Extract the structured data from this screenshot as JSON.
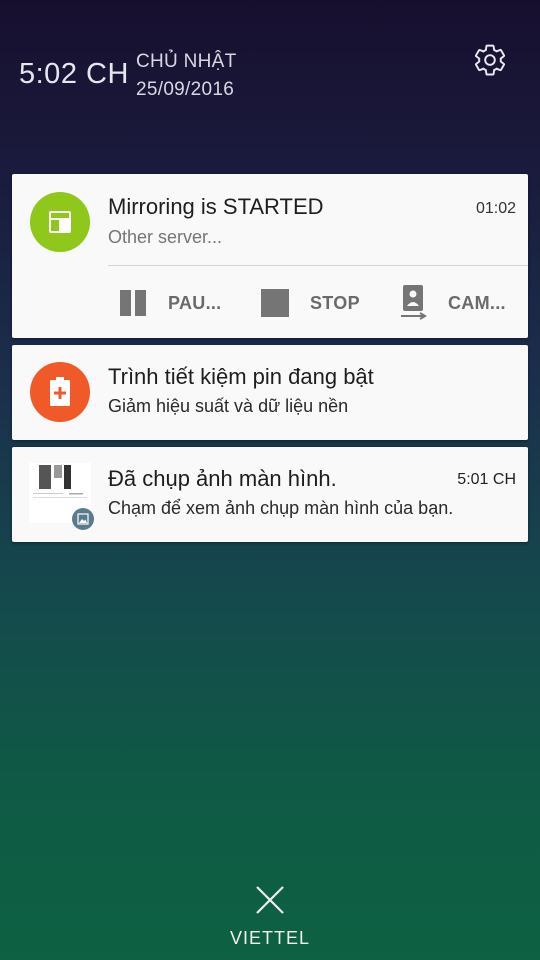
{
  "header": {
    "clock": "5:02 CH",
    "day_name": "CHỦ NHẬT",
    "date": "25/09/2016",
    "settings_icon": "gear-icon"
  },
  "notifications": [
    {
      "app_icon": "screen-mirror-icon",
      "icon_color": "#8fc71b",
      "title": "Mirroring is STARTED",
      "subtitle": "Other server...",
      "time": "01:02",
      "actions": [
        {
          "label": "PAU...",
          "icon": "pause-icon"
        },
        {
          "label": "STOP",
          "icon": "stop-icon"
        },
        {
          "label": "CAM...",
          "icon": "camera-switch-icon"
        }
      ]
    },
    {
      "app_icon": "battery-saver-icon",
      "icon_color": "#f05a28",
      "title": "Trình tiết kiệm pin đang bật",
      "subtitle": "Giảm hiệu suất và dữ liệu nền"
    },
    {
      "app_icon": "image-icon",
      "title": "Đã chụp ảnh màn hình.",
      "subtitle": "Chạm để xem ảnh chụp màn hình của bạn.",
      "time": "5:01 CH"
    }
  ],
  "footer": {
    "dismiss_icon": "close-icon",
    "carrier": "VIETTEL"
  }
}
